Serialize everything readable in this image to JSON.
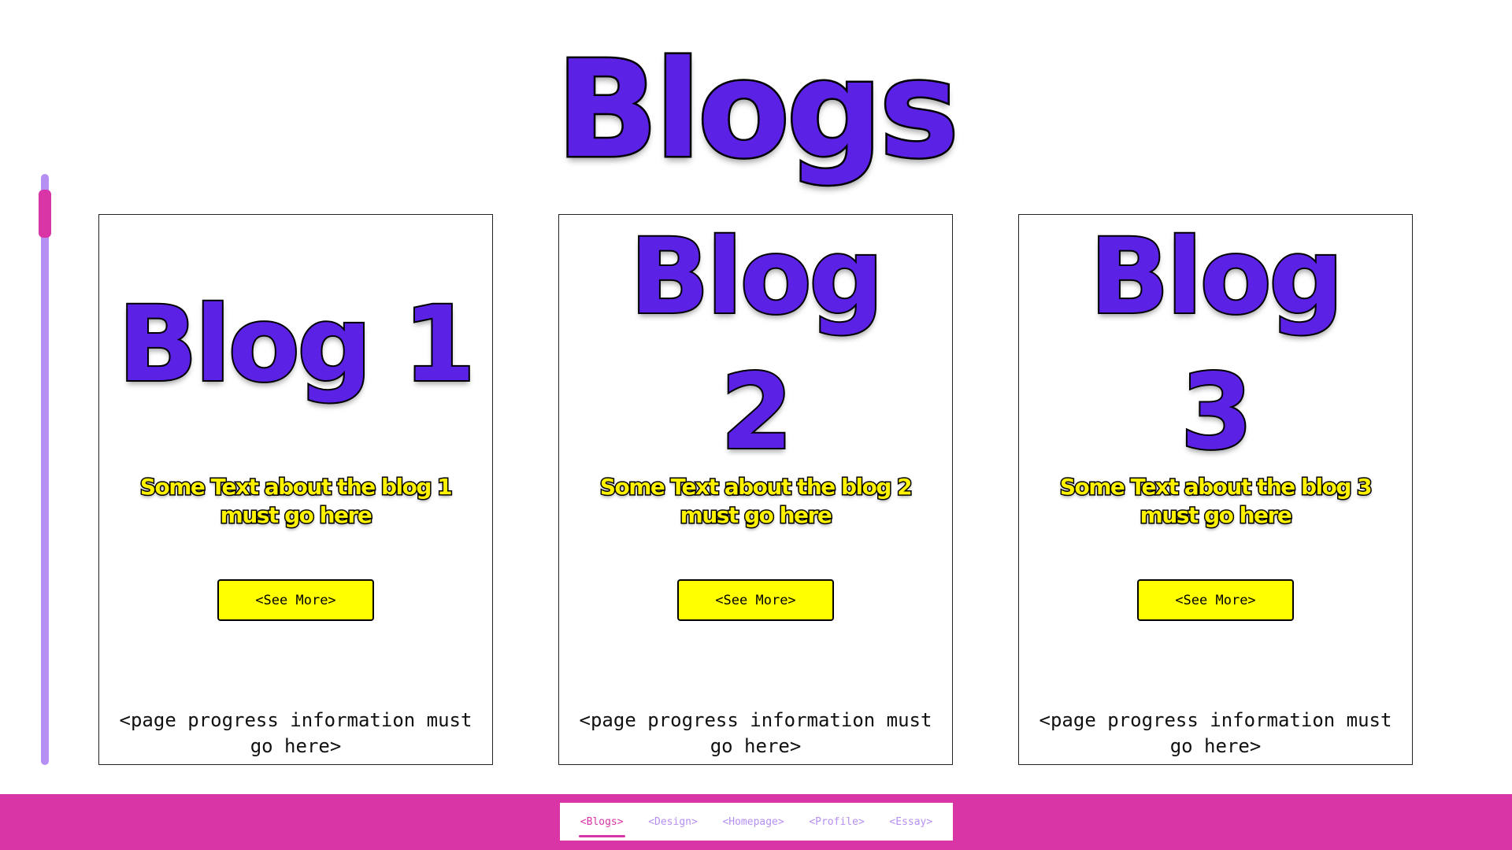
{
  "page": {
    "title": "Blogs"
  },
  "scrollbar": {
    "orientation": "vertical",
    "track_color": "#b58ff3",
    "thumb_color": "#d935a6"
  },
  "cards": [
    {
      "title": "Blog 1",
      "text": "Some Text about the blog 1 must go here",
      "button_label": "<See More>",
      "progress_text": "<page progress information must go here>"
    },
    {
      "title": "Blog 2",
      "text": "Some Text about the blog 2 must go here",
      "button_label": "<See More>",
      "progress_text": "<page progress information must go here>"
    },
    {
      "title": "Blog 3",
      "text": "Some Text about the blog 3 must go here",
      "button_label": "<See More>",
      "progress_text": "<page progress information must go here>"
    }
  ],
  "nav": {
    "active": "<Blogs>",
    "tabs": [
      {
        "label": "<Blogs>"
      },
      {
        "label": "<Design>"
      },
      {
        "label": "<Homepage>"
      },
      {
        "label": "<Profile>"
      },
      {
        "label": "<Essay>"
      }
    ]
  },
  "colors": {
    "accent_purple": "#5b22e6",
    "accent_yellow": "#fff200",
    "button_yellow": "#ffff00",
    "footer_pink": "#d935a6",
    "nav_inactive": "#b58ff3"
  }
}
